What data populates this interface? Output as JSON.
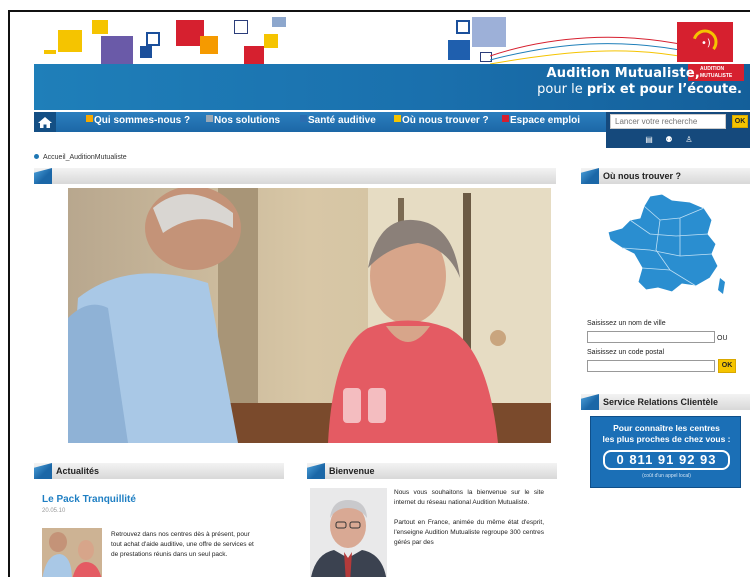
{
  "header": {
    "tagline_line1": "Audition Mutualiste,",
    "tagline_line2_pre": "pour le ",
    "tagline_line2_bold": "prix et pour l’écoute.",
    "logo_text": "AUDITION MUTUALISTE"
  },
  "nav": {
    "items": [
      {
        "label": "Qui sommes-nous ?",
        "marker": "#f5a800"
      },
      {
        "label": "Nos solutions",
        "marker": "#9aa8b5"
      },
      {
        "label": "Santé auditive",
        "marker": "#2b6db0"
      },
      {
        "label": "Où nous trouver ?",
        "marker": "#f5c400"
      },
      {
        "label": "Espace emploi",
        "marker": "#d6202f"
      }
    ]
  },
  "search": {
    "placeholder": "Lancer votre recherche",
    "ok_label": "OK"
  },
  "breadcrumb": "Accueil_AuditionMutualiste",
  "where": {
    "title": "Où nous trouver ?",
    "city_label": "Saisissez un nom de ville",
    "or_label": "OU",
    "postal_label": "Saisissez un code postal",
    "ok_label": "OK"
  },
  "service": {
    "title": "Service Relations Clientèle",
    "line1": "Pour connaître les centres",
    "line2": "les plus proches de chez vous :",
    "phone": "0 811 91 92 93",
    "note": "(coût d'un appel local)"
  },
  "news": {
    "title": "Actualités",
    "item_title": "Le Pack Tranquillité",
    "item_date": "20.05.10",
    "item_text": "Retrouvez dans nos centres dès à présent, pour tout achat d'aide auditive, une offre de services et de prestations réunis dans un seul pack."
  },
  "welcome": {
    "title": "Bienvenue",
    "para1": "Nous vous souhaitons la bienvenue sur le site internet du réseau national Audition Mutualiste.",
    "para2": "Partout en France, animée du même état d'esprit, l'enseigne Audition Mutualiste regroupe 300 centres gérés par des"
  },
  "colors": {
    "brand_blue": "#1f7fb9",
    "accent_yellow": "#f5c400",
    "accent_red": "#d6202f"
  }
}
